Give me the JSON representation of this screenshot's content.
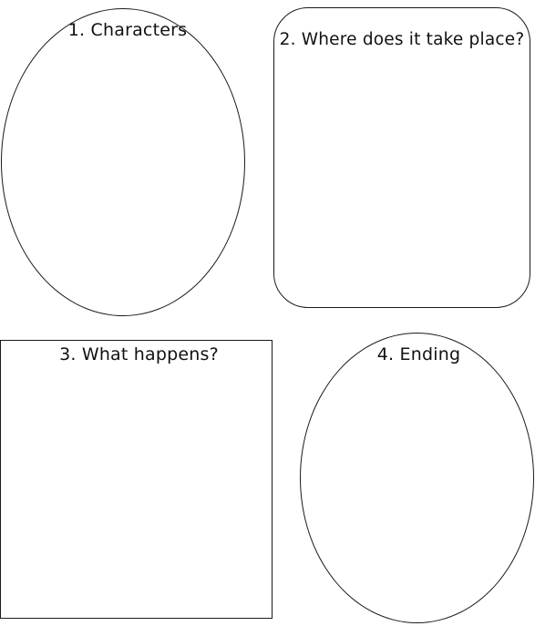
{
  "worksheet": {
    "boxes": [
      {
        "id": "characters",
        "label": "1. Characters"
      },
      {
        "id": "setting",
        "label": "2. Where does it take place?"
      },
      {
        "id": "events",
        "label": "3. What happens?"
      },
      {
        "id": "ending",
        "label": "4. Ending"
      }
    ],
    "colors": {
      "outline": "#1a1a1a",
      "text": "#111111",
      "background": "#ffffff"
    }
  }
}
